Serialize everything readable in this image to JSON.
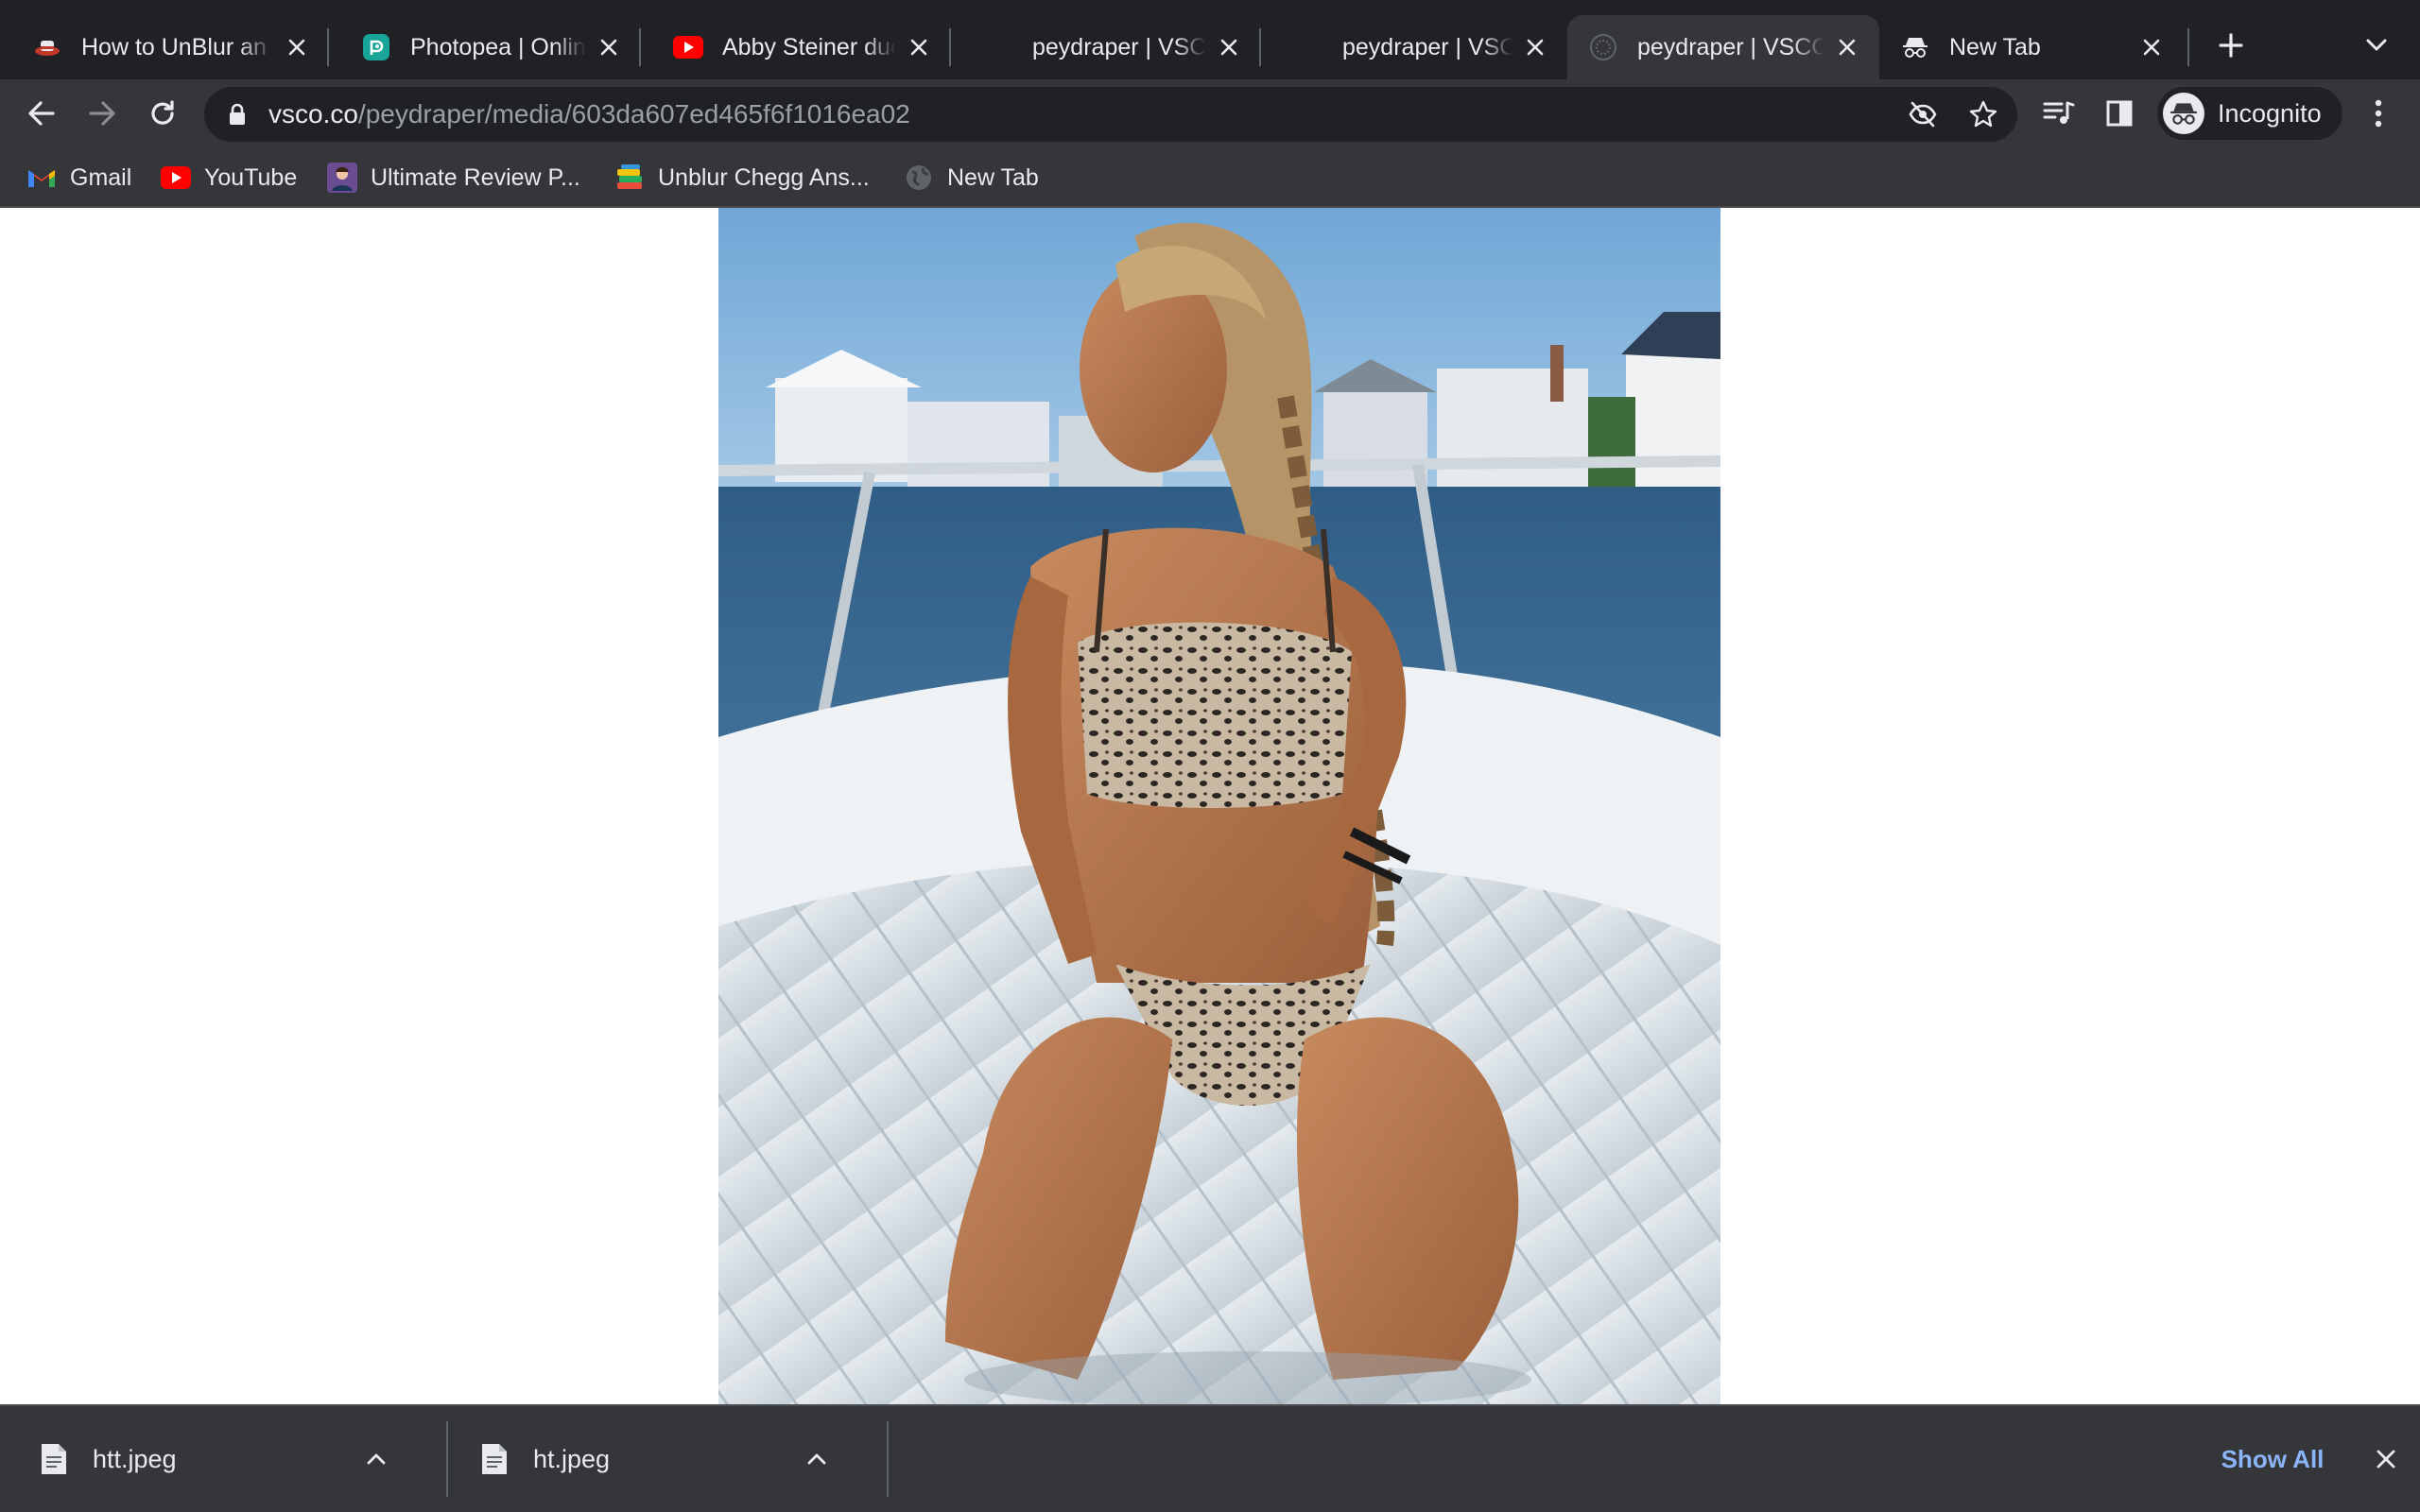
{
  "browser": {
    "tabs": [
      {
        "title": "How to UnBlur an",
        "favicon": "hat-icon",
        "active": false
      },
      {
        "title": "Photopea | Online",
        "favicon": "photopea-icon",
        "active": false
      },
      {
        "title": "Abby Steiner duel",
        "favicon": "youtube-icon",
        "active": false
      },
      {
        "title": "peydraper | VSCO",
        "favicon": "vsco-icon",
        "active": false
      },
      {
        "title": "peydraper | VSCO",
        "favicon": "vsco-icon",
        "active": false
      },
      {
        "title": "peydraper | VSCO",
        "favicon": "vsco-icon",
        "active": true
      },
      {
        "title": "New Tab",
        "favicon": "incognito-icon",
        "active": false
      }
    ],
    "address_bar": {
      "host": "vsco.co",
      "path": "/peydraper/media/603da607ed465f6f1016ea02"
    },
    "profile_label": "Incognito",
    "colors": {
      "frame": "#202124",
      "toolbar": "#35363a",
      "text": "#e8eaed",
      "link": "#8ab4f8"
    }
  },
  "bookmarks": [
    {
      "label": "Gmail",
      "icon": "gmail-icon"
    },
    {
      "label": "YouTube",
      "icon": "youtube-icon"
    },
    {
      "label": "Ultimate Review P...",
      "icon": "avatar-icon"
    },
    {
      "label": "Unblur Chegg Ans...",
      "icon": "books-icon"
    },
    {
      "label": "New Tab",
      "icon": "globe-icon"
    }
  ],
  "downloads": {
    "items": [
      {
        "filename": "htt.jpeg"
      },
      {
        "filename": "ht.jpeg"
      }
    ],
    "show_all_label": "Show All"
  }
}
